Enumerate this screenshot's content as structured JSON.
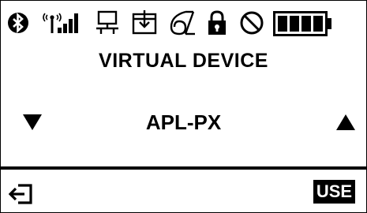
{
  "status_bar": {
    "icons": [
      "bluetooth-icon",
      "signal-strength-icon",
      "network-icon",
      "inbox-icon",
      "sleep-icon",
      "lock-icon",
      "no-entry-icon",
      "battery-icon"
    ],
    "battery_level": 1.0
  },
  "main": {
    "title": "VIRTUAL DEVICE",
    "device_name": "APL-PX",
    "prev_arrow": "▼",
    "next_arrow": "▲"
  },
  "footer": {
    "back_icon": "back-exit-icon",
    "use_label": "USE"
  },
  "colors": {
    "background": "#ffffff",
    "foreground": "#000000"
  }
}
